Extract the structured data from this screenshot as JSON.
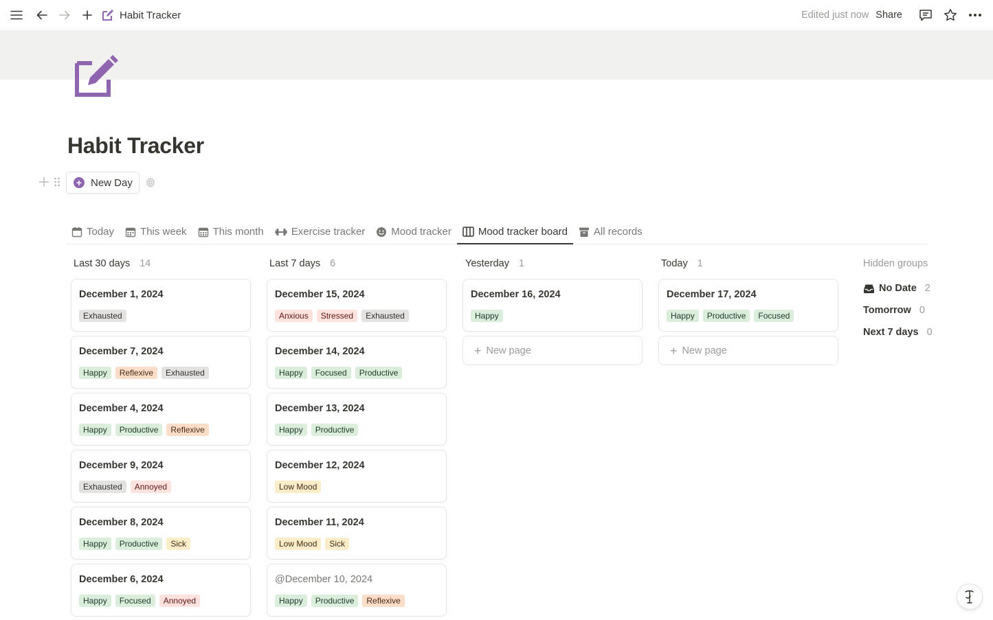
{
  "topbar": {
    "breadcrumb_title": "Habit Tracker",
    "edited": "Edited just now",
    "share": "Share"
  },
  "page": {
    "title": "Habit Tracker",
    "new_day_label": "New Day",
    "accent_color": "#9065b0"
  },
  "tabs": [
    {
      "label": "Today",
      "icon": "calendar-icon",
      "active": false
    },
    {
      "label": "This week",
      "icon": "calendar-week-icon",
      "active": false
    },
    {
      "label": "This month",
      "icon": "calendar-month-icon",
      "active": false
    },
    {
      "label": "Exercise tracker",
      "icon": "dumbbell-icon",
      "active": false
    },
    {
      "label": "Mood tracker",
      "icon": "smiley-icon",
      "active": false
    },
    {
      "label": "Mood tracker board",
      "icon": "board-icon",
      "active": true
    },
    {
      "label": "All records",
      "icon": "archive-icon",
      "active": false
    }
  ],
  "board": {
    "columns": [
      {
        "title": "Last 30 days",
        "count": "14",
        "cards": [
          {
            "title": "December 1, 2024",
            "tags": [
              {
                "label": "Exhausted",
                "color": "gray"
              }
            ]
          },
          {
            "title": "December 7, 2024",
            "tags": [
              {
                "label": "Happy",
                "color": "green"
              },
              {
                "label": "Reflexive",
                "color": "orange"
              },
              {
                "label": "Exhausted",
                "color": "gray"
              }
            ]
          },
          {
            "title": "December 4, 2024",
            "tags": [
              {
                "label": "Happy",
                "color": "green"
              },
              {
                "label": "Productive",
                "color": "green"
              },
              {
                "label": "Reflexive",
                "color": "orange"
              }
            ]
          },
          {
            "title": "December 9, 2024",
            "tags": [
              {
                "label": "Exhausted",
                "color": "gray"
              },
              {
                "label": "Annoyed",
                "color": "red"
              }
            ]
          },
          {
            "title": "December 8, 2024",
            "tags": [
              {
                "label": "Happy",
                "color": "green"
              },
              {
                "label": "Productive",
                "color": "green"
              },
              {
                "label": "Sick",
                "color": "yellow"
              }
            ]
          },
          {
            "title": "December 6, 2024",
            "tags": [
              {
                "label": "Happy",
                "color": "green"
              },
              {
                "label": "Focused",
                "color": "green"
              },
              {
                "label": "Annoyed",
                "color": "red"
              }
            ]
          }
        ]
      },
      {
        "title": "Last 7 days",
        "count": "6",
        "cards": [
          {
            "title": "December 15, 2024",
            "tags": [
              {
                "label": "Anxious",
                "color": "red"
              },
              {
                "label": "Stressed",
                "color": "red"
              },
              {
                "label": "Exhausted",
                "color": "gray"
              }
            ]
          },
          {
            "title": "December 14, 2024",
            "tags": [
              {
                "label": "Happy",
                "color": "green"
              },
              {
                "label": "Focused",
                "color": "green"
              },
              {
                "label": "Productive",
                "color": "green"
              }
            ]
          },
          {
            "title": "December 13, 2024",
            "tags": [
              {
                "label": "Happy",
                "color": "green"
              },
              {
                "label": "Productive",
                "color": "green"
              }
            ]
          },
          {
            "title": "December 12, 2024",
            "tags": [
              {
                "label": "Low Mood",
                "color": "yellow"
              }
            ]
          },
          {
            "title": "December 11, 2024",
            "tags": [
              {
                "label": "Low Mood",
                "color": "yellow"
              },
              {
                "label": "Sick",
                "color": "yellow"
              }
            ]
          },
          {
            "title": "@December 10, 2024",
            "muted": true,
            "tags": [
              {
                "label": "Happy",
                "color": "green"
              },
              {
                "label": "Productive",
                "color": "green"
              },
              {
                "label": "Reflexive",
                "color": "orange"
              }
            ]
          }
        ]
      },
      {
        "title": "Yesterday",
        "count": "1",
        "cards": [
          {
            "title": "December 16, 2024",
            "tags": [
              {
                "label": "Happy",
                "color": "green"
              }
            ]
          }
        ],
        "new_page": "New page"
      },
      {
        "title": "Today",
        "count": "1",
        "cards": [
          {
            "title": "December 17, 2024",
            "tags": [
              {
                "label": "Happy",
                "color": "green"
              },
              {
                "label": "Productive",
                "color": "green"
              },
              {
                "label": "Focused",
                "color": "green"
              }
            ]
          }
        ],
        "new_page": "New page"
      }
    ],
    "hidden_groups": {
      "title": "Hidden groups",
      "groups": [
        {
          "label": "No Date",
          "count": "2"
        },
        {
          "label": "Tomorrow",
          "count": "0"
        },
        {
          "label": "Next 7 days",
          "count": "0"
        }
      ]
    }
  }
}
